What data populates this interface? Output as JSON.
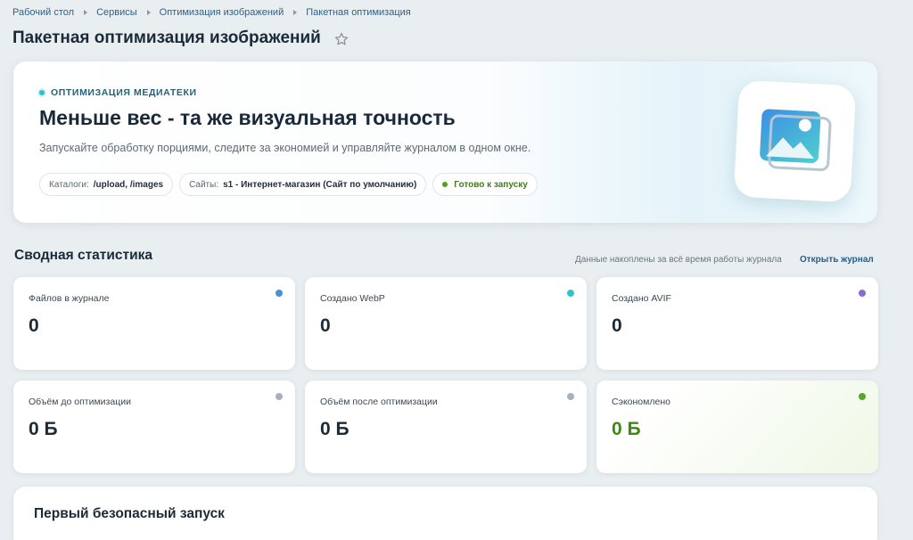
{
  "breadcrumb": [
    "Рабочий стол",
    "Сервисы",
    "Оптимизация изображений",
    "Пакетная оптимизация"
  ],
  "page_title": "Пакетная оптимизация изображений",
  "hero": {
    "badge": "ОПТИМИЗАЦИЯ МЕДИАТЕКИ",
    "title": "Меньше вес - та же визуальная точность",
    "subtitle": "Запускайте обработку порциями, следите за экономией и управляйте журналом в одном окне.",
    "catalogs_label": "Каталоги:",
    "catalogs_value": "/upload, /images",
    "sites_label": "Сайты:",
    "sites_value": "s1 - Интернет-магазин (Сайт по умолчанию)",
    "status": "Готово к запуску",
    "icon": "image-icon"
  },
  "summary": {
    "title": "Сводная статистика",
    "note": "Данные накоплены за всё время работы журнала",
    "open_log": "Открыть журнал",
    "cards": [
      {
        "label": "Файлов в журнале",
        "value": "0",
        "color": "#4a8fdc"
      },
      {
        "label": "Создано WebP",
        "value": "0",
        "color": "#35bfc9"
      },
      {
        "label": "Создано AVIF",
        "value": "0",
        "color": "#8a6bd2"
      },
      {
        "label": "Объём до оптимизации",
        "value": "0 Б",
        "color": "#a8b0ba"
      },
      {
        "label": "Объём после оптимизации",
        "value": "0 Б",
        "color": "#a8b0ba"
      },
      {
        "label": "Сэкономлено",
        "value": "0 Б",
        "color": "#56a82a"
      }
    ]
  },
  "next_section": {
    "title": "Первый безопасный запуск"
  }
}
